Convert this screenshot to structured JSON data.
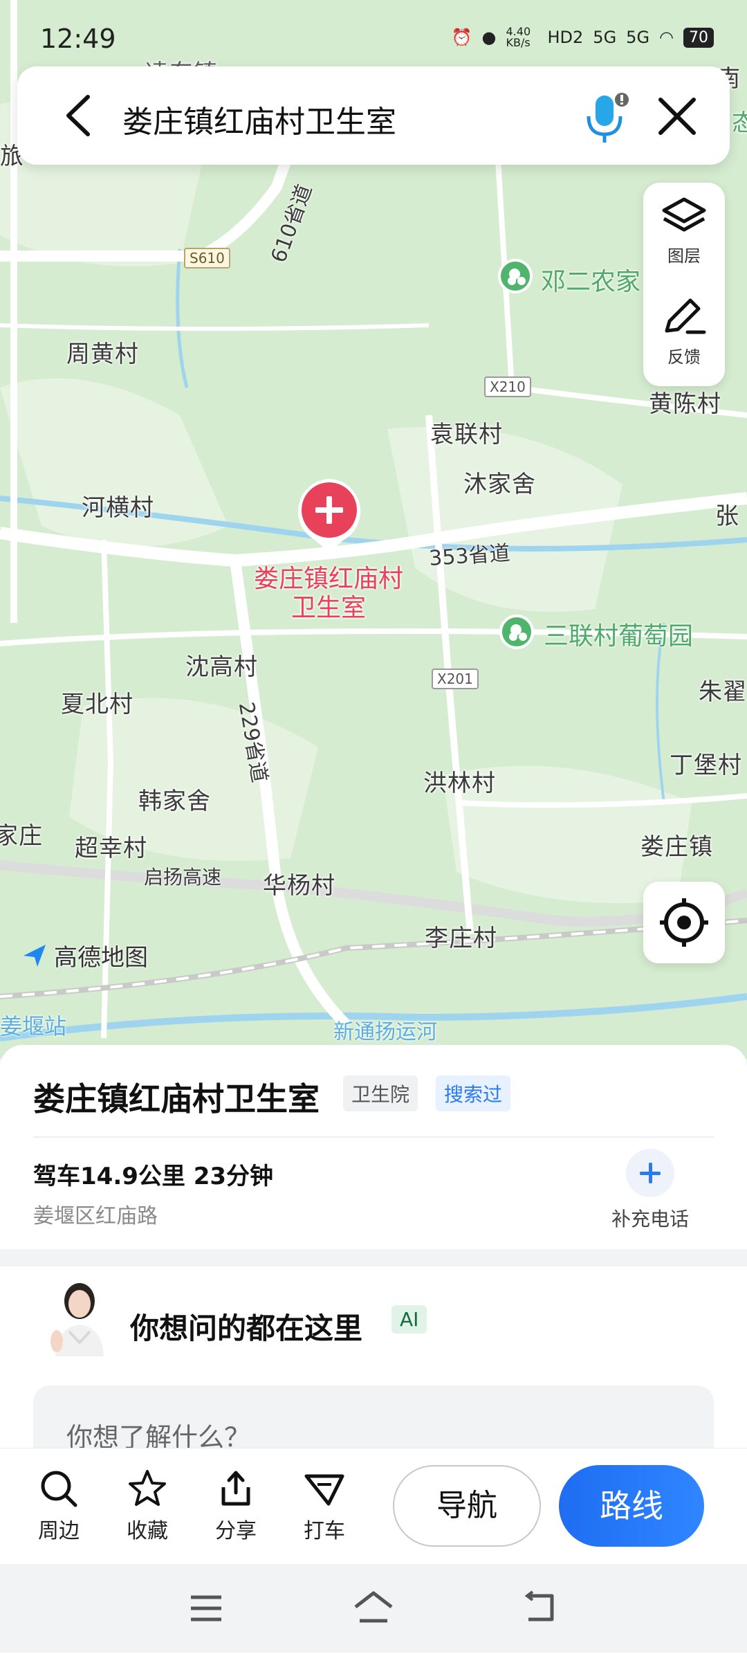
{
  "status": {
    "time": "12:49",
    "net_speed": "4.40 KB/s",
    "battery": "70",
    "hd": "HD2",
    "sig1": "5G",
    "sig2": "5G"
  },
  "search": {
    "query": "娄庄镇红庙村卫生室"
  },
  "tools": {
    "layers": "图层",
    "feedback": "反馈"
  },
  "map": {
    "labels": [
      "周黄村",
      "河横村",
      "袁联村",
      "沐家舍",
      "黄陈村",
      "沈高村",
      "夏北村",
      "韩家舍",
      "洪林村",
      "超幸村",
      "华杨村",
      "李庄村",
      "娄庄镇",
      "丁堡村",
      "朱翟",
      "张"
    ],
    "roads": {
      "s610_text": "610省道",
      "s353_text": "353省道",
      "s229_text": "229省道",
      "expressway": "启扬高速",
      "canal": "新通扬运河",
      "station": "姜堰站"
    },
    "shields": {
      "s610": "S610",
      "x210": "X210",
      "x201": "X201"
    },
    "pois": {
      "p1": "邓二农家",
      "p2": "三联村葡萄园"
    },
    "pin_label": "娄庄镇红庙村卫生室",
    "logo_text": "高德地图",
    "edge_text": {
      "top": "凌东镇",
      "left_mid": "旅",
      "left_low": "家庄",
      "top_right": "南",
      "right_top": "态"
    }
  },
  "place": {
    "title": "娄庄镇红庙村卫生室",
    "tag_category": "卫生院",
    "tag_searched": "搜索过",
    "drive_info": "驾车14.9公里 23分钟",
    "address": "姜堰区红庙路",
    "add_phone": "补充电话"
  },
  "ai": {
    "title": "你想问的都在这里",
    "badge": "AI",
    "placeholder": "你想了解什么？"
  },
  "actions": {
    "nearby": "周边",
    "favorite": "收藏",
    "share": "分享",
    "taxi": "打车",
    "navigate": "导航",
    "route": "路线"
  },
  "colors": {
    "accent": "#2a7af0",
    "pin": "#e8425a",
    "map_green": "#d6ecd0",
    "poi_green": "#4fb56d"
  }
}
